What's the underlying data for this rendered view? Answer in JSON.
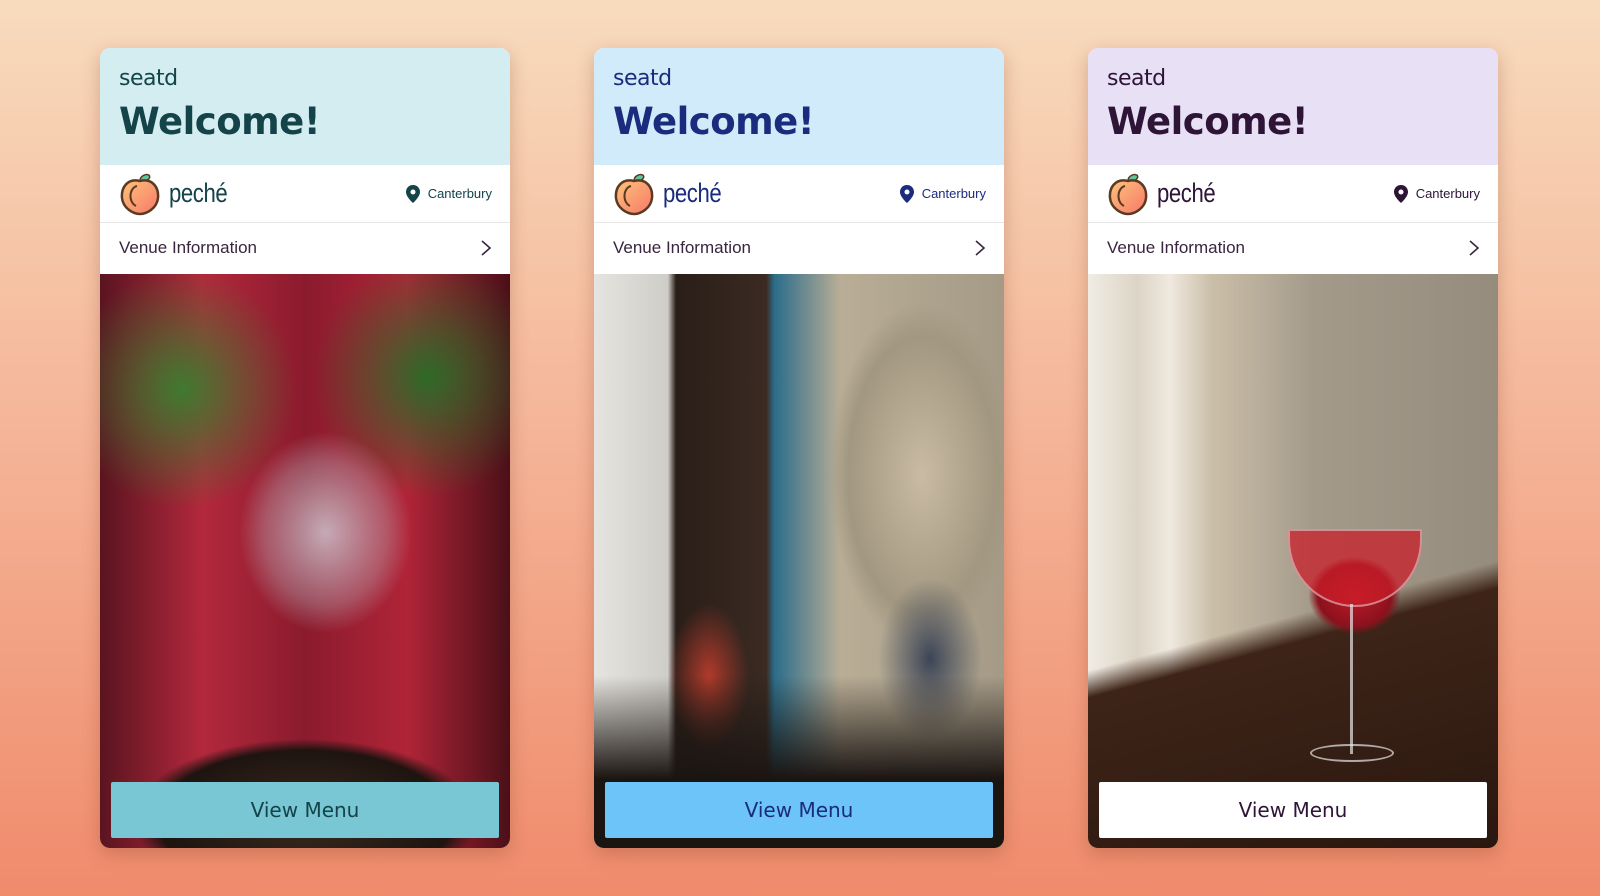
{
  "cards": [
    {
      "theme": "teal",
      "brand": "seatd",
      "welcome": "Welcome!",
      "venue_name": "peché",
      "location": "Canterbury",
      "venue_info_label": "Venue Information",
      "photo": "bar-interior-red-photo",
      "cta_label": "View Menu",
      "colors": {
        "header_bg": "#d4edf0",
        "text": "#14434a",
        "button_bg": "#79c6d4",
        "button_text": "#14434a"
      }
    },
    {
      "theme": "blue",
      "brand": "seatd",
      "welcome": "Welcome!",
      "venue_name": "peché",
      "location": "Canterbury",
      "venue_info_label": "Venue Information",
      "photo": "cafe-couple-window-photo",
      "cta_label": "View Menu",
      "colors": {
        "header_bg": "#d2ebfa",
        "text": "#1b2b7d",
        "button_bg": "#6cc4f8",
        "button_text": "#1b2b7d"
      }
    },
    {
      "theme": "lavender",
      "brand": "seatd",
      "welcome": "Welcome!",
      "venue_name": "peché",
      "location": "Canterbury",
      "venue_info_label": "Venue Information",
      "photo": "cocktail-glass-photo",
      "cta_label": "View Menu",
      "colors": {
        "header_bg": "#e8e0f5",
        "text": "#2e1538",
        "button_bg": "#ffffff",
        "button_text": "#2e1538"
      }
    }
  ],
  "icons": {
    "venue_logo": "peach-icon",
    "location": "map-pin-icon",
    "chevron": "chevron-right-icon"
  }
}
